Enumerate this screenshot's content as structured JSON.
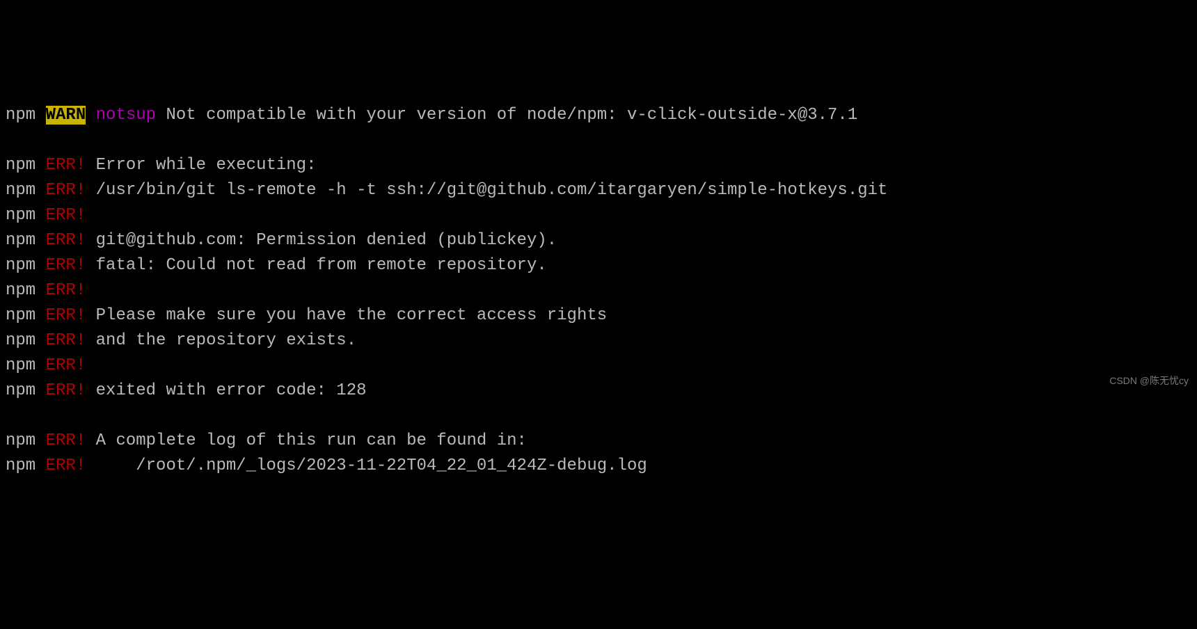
{
  "lines": [
    {
      "npm": "npm",
      "tag": "WARN",
      "tagClass": "warn",
      "sub": "notsup",
      "subClass": "notsup",
      "msg": " Not compatible with your version of node/npm: v-click-outside-x@3.7.1"
    },
    {
      "blank": true
    },
    {
      "npm": "npm",
      "tag": "ERR!",
      "tagClass": "err",
      "msg": " Error while executing:"
    },
    {
      "npm": "npm",
      "tag": "ERR!",
      "tagClass": "err",
      "msg": " /usr/bin/git ls-remote -h -t ssh://git@github.com/itargaryen/simple-hotkeys.git"
    },
    {
      "npm": "npm",
      "tag": "ERR!",
      "tagClass": "err",
      "msg": ""
    },
    {
      "npm": "npm",
      "tag": "ERR!",
      "tagClass": "err",
      "msg": " git@github.com: Permission denied (publickey)."
    },
    {
      "npm": "npm",
      "tag": "ERR!",
      "tagClass": "err",
      "msg": " fatal: Could not read from remote repository."
    },
    {
      "npm": "npm",
      "tag": "ERR!",
      "tagClass": "err",
      "msg": ""
    },
    {
      "npm": "npm",
      "tag": "ERR!",
      "tagClass": "err",
      "msg": " Please make sure you have the correct access rights"
    },
    {
      "npm": "npm",
      "tag": "ERR!",
      "tagClass": "err",
      "msg": " and the repository exists."
    },
    {
      "npm": "npm",
      "tag": "ERR!",
      "tagClass": "err",
      "msg": ""
    },
    {
      "npm": "npm",
      "tag": "ERR!",
      "tagClass": "err",
      "msg": " exited with error code: 128"
    },
    {
      "blank": true
    },
    {
      "npm": "npm",
      "tag": "ERR!",
      "tagClass": "err",
      "msg": " A complete log of this run can be found in:"
    },
    {
      "npm": "npm",
      "tag": "ERR!",
      "tagClass": "err",
      "msg": "     /root/.npm/_logs/2023-11-22T04_22_01_424Z-debug.log"
    }
  ],
  "watermark": "CSDN @陈无忧cy"
}
